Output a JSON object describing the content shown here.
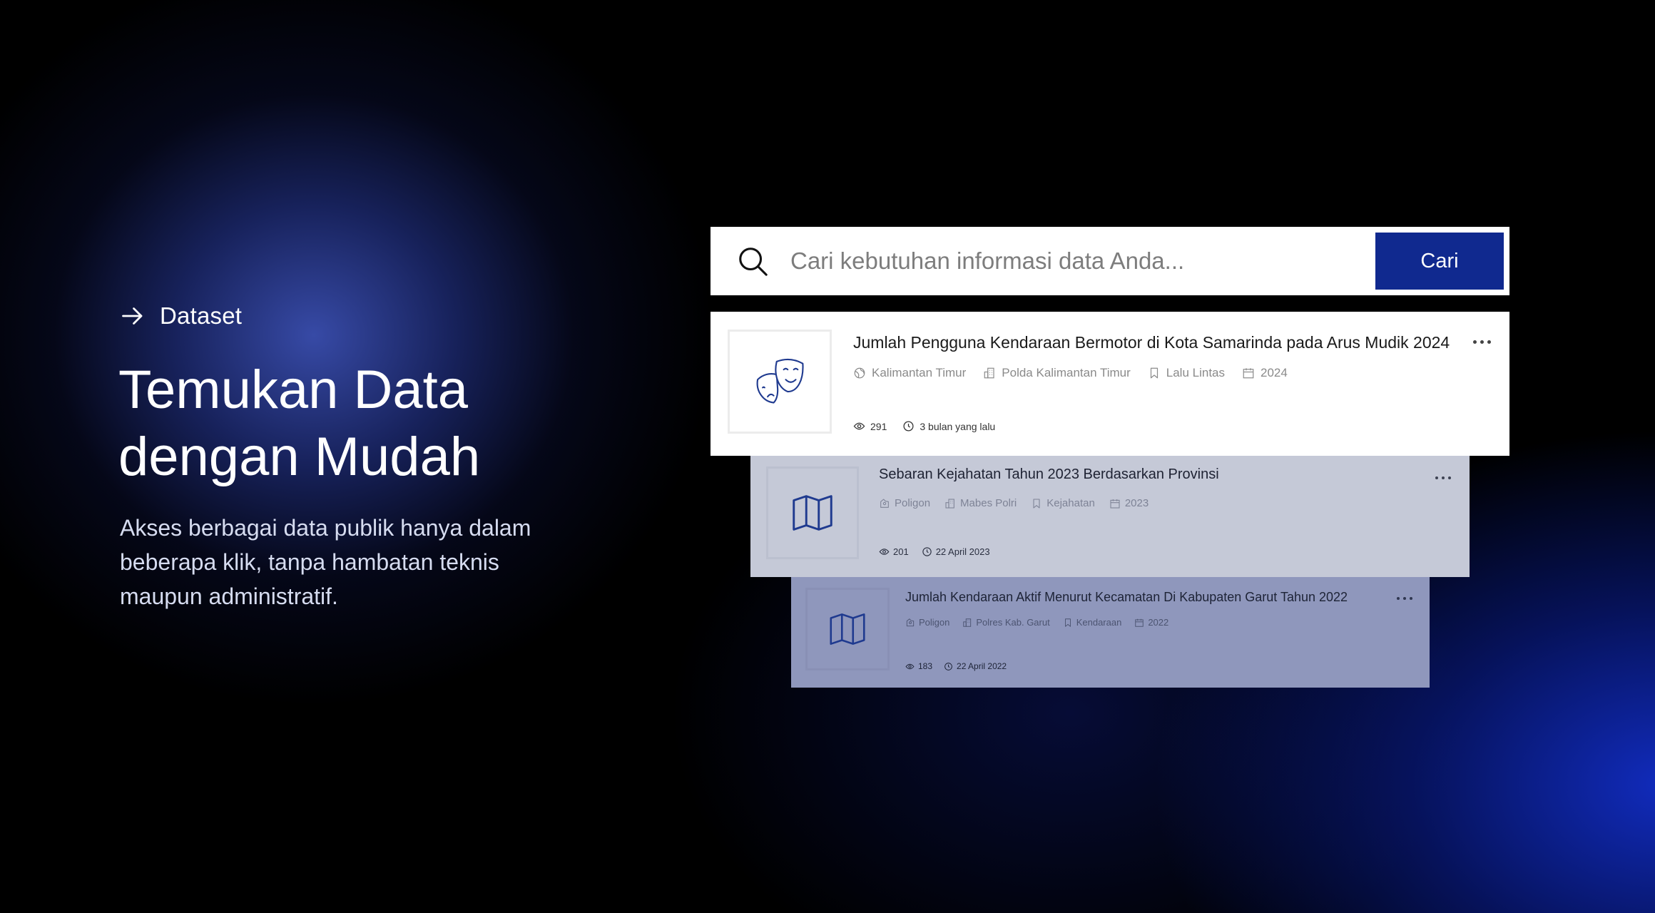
{
  "hero": {
    "eyebrow": "Dataset",
    "title_line1": "Temukan Data",
    "title_line2": "dengan Mudah",
    "description": "Akses berbagai data publik hanya dalam beberapa klik, tanpa hambatan teknis maupun administratif."
  },
  "search": {
    "placeholder": "Cari kebutuhan informasi data Anda...",
    "button_label": "Cari"
  },
  "colors": {
    "accent": "#10298f",
    "icon_stroke": "#1f3a8f"
  },
  "results": [
    {
      "title": "Jumlah Pengguna Kendaraan Bermotor di Kota Samarinda pada Arus Mudik 2024",
      "thumbnail_icon": "theater-masks-icon",
      "region": "Kalimantan Timur",
      "organization": "Polda Kalimantan Timur",
      "topic": "Lalu Lintas",
      "year": "2024",
      "views": "291",
      "updated": "3 bulan yang lalu"
    },
    {
      "title": "Sebaran Kejahatan Tahun 2023 Berdasarkan Provinsi",
      "thumbnail_icon": "map-icon",
      "region": "Poligon",
      "organization": "Mabes Polri",
      "topic": "Kejahatan",
      "year": "2023",
      "views": "201",
      "updated": "22 April 2023"
    },
    {
      "title": "Jumlah Kendaraan Aktif Menurut Kecamatan Di Kabupaten Garut Tahun 2022",
      "thumbnail_icon": "map-icon",
      "region": "Poligon",
      "organization": "Polres Kab. Garut",
      "topic": "Kendaraan",
      "year": "2022",
      "views": "183",
      "updated": "22 April 2022"
    }
  ]
}
